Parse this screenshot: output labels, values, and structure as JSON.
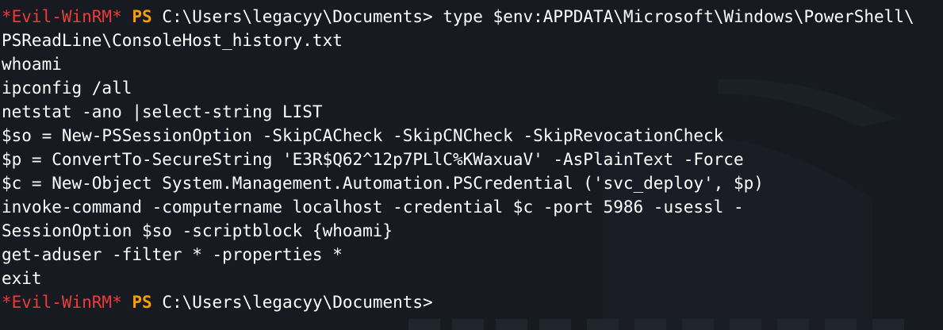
{
  "prompt": {
    "evil_label": "*Evil-WinRM*",
    "ps_label": "PS",
    "path": "C:\\Users\\legacyy\\Documents>"
  },
  "command_line": {
    "command": "type $env:APPDATA\\Microsoft\\Windows\\PowerShell\\",
    "continuation": "PSReadLine\\ConsoleHost_history.txt"
  },
  "output_lines": [
    "whoami",
    "ipconfig /all",
    "netstat -ano |select-string LIST",
    "$so = New-PSSessionOption -SkipCACheck -SkipCNCheck -SkipRevocationCheck",
    "$p = ConvertTo-SecureString 'E3R$Q62^12p7PLlC%KWaxuaV' -AsPlainText -Force",
    "$c = New-Object System.Management.Automation.PSCredential ('svc_deploy', $p)",
    "invoke-command -computername localhost -credential $c -port 5986 -usessl -",
    "SessionOption $so -scriptblock {whoami}",
    "get-aduser -filter * -properties *",
    "exit"
  ],
  "colors": {
    "background": "#171a21",
    "evil": "#ee3a3a",
    "ps": "#f5a000",
    "text": "#ffffff"
  }
}
